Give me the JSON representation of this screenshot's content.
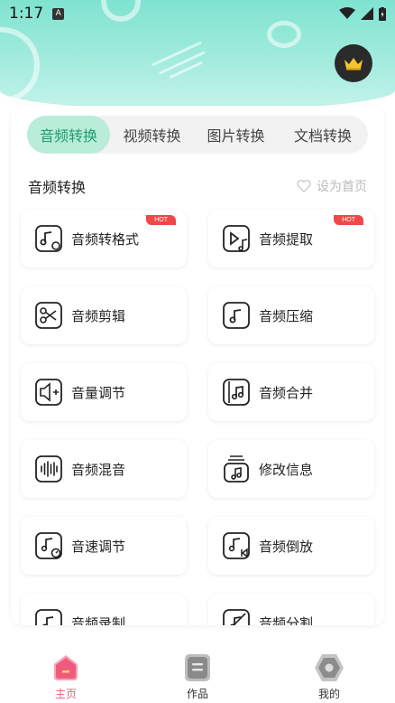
{
  "status_bar": {
    "time": "1:17",
    "notif_glyph": "A"
  },
  "tabs": [
    {
      "label": "音频转换",
      "active": true
    },
    {
      "label": "视频转换",
      "active": false
    },
    {
      "label": "图片转换",
      "active": false
    },
    {
      "label": "文档转换",
      "active": false
    }
  ],
  "section": {
    "title": "音频转换",
    "set_home_label": "设为首页"
  },
  "tools": [
    {
      "label": "音频转格式",
      "icon": "audio-convert-icon",
      "hot": true
    },
    {
      "label": "音频提取",
      "icon": "audio-extract-icon",
      "hot": true
    },
    {
      "label": "音频剪辑",
      "icon": "scissors-icon",
      "hot": false
    },
    {
      "label": "音频压缩",
      "icon": "audio-compress-icon",
      "hot": false
    },
    {
      "label": "音量调节",
      "icon": "volume-icon",
      "hot": false
    },
    {
      "label": "音频合并",
      "icon": "audio-merge-icon",
      "hot": false
    },
    {
      "label": "音频混音",
      "icon": "waveform-icon",
      "hot": false
    },
    {
      "label": "修改信息",
      "icon": "edit-info-icon",
      "hot": false
    },
    {
      "label": "音速调节",
      "icon": "speed-icon",
      "hot": false
    },
    {
      "label": "音频倒放",
      "icon": "reverse-icon",
      "hot": false
    },
    {
      "label": "音频录制",
      "icon": "record-icon",
      "hot": false
    },
    {
      "label": "音频分割",
      "icon": "split-icon",
      "hot": false
    }
  ],
  "hot_badge": "HOT",
  "bottom_nav": [
    {
      "label": "主页",
      "active": true
    },
    {
      "label": "作品",
      "active": false
    },
    {
      "label": "我的",
      "active": false
    }
  ],
  "colors": {
    "accent": "#1f9e6e",
    "active_tab_bg": "#b9ecd9",
    "hot": "#f04848",
    "nav_active": "#ef5b7c",
    "header": "#7fe3cf"
  }
}
